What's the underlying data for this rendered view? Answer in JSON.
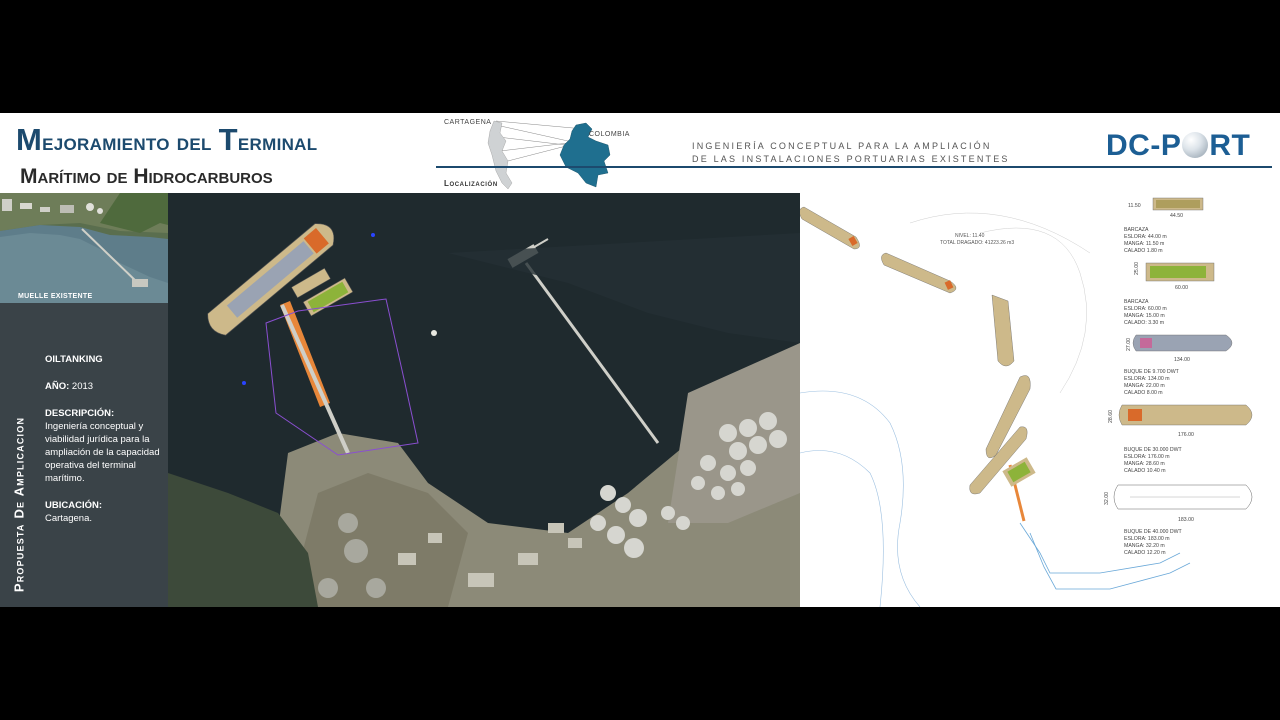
{
  "header": {
    "title_line1_a": "M",
    "title_line1_b": "ejoramiento",
    "title_line1_c": "del",
    "title_line1_d": "T",
    "title_line1_e": "erminal",
    "title_line2": "Marítimo de Hidrocarburos",
    "map_label_city": "CARTAGENA",
    "map_label_country": "COLOMBIA",
    "localizacion_label": "Localización",
    "subtitle_line1": "INGENIERÍA CONCEPTUAL PARA LA AMPLIACIÓN",
    "subtitle_line2": "DE LAS INSTALACIONES PORTUARIAS EXISTENTES",
    "brand_a": "DC-P",
    "brand_b": "RT"
  },
  "left_panel": {
    "photo_caption": "MUELLE EXISTENTE",
    "vertical_title": "Propuesta De Amplicacion",
    "client": "OILTANKING",
    "year_label": "AÑO:",
    "year_value": "2013",
    "description_label": "DESCRIPCIÓN:",
    "description_text": "Ingeniería conceptual y viabilidad jurídica para la ampliación de la capacidad operativa del terminal marítimo.",
    "location_label": "UBICACIÓN:",
    "location_value": "Cartagena."
  },
  "plan": {
    "nivel": "NIVEL: 11.40",
    "dragado": "TOTAL DRAGADO: 41223.26 m3",
    "legend": [
      {
        "dim_top": "11.50",
        "dim_bottom": "44.50",
        "lines": []
      },
      {
        "dim_top": "25.00",
        "dim_bottom": "60.00",
        "lines": [
          "BARCAZA",
          "ESLORA: 44.00 m",
          "MANGA: 11.50 m",
          "CALADO 1.80 m"
        ]
      },
      {
        "dim_top": "27.00",
        "dim_bottom": "134.00",
        "lines": [
          "BARCAZA",
          "ESLORA: 60.00 m",
          "MANGA: 15.00 m",
          "CALADO: 3.30 m"
        ]
      },
      {
        "dim_top": "28.60",
        "dim_bottom": "176.00",
        "lines": [
          "BUQUE DE 9.700 DWT",
          "ESLORA: 134.00 m",
          "MANGA: 22.00 m",
          "CALADO 8.00 m"
        ]
      },
      {
        "dim_top": "32.00",
        "dim_bottom": "183.00",
        "lines": [
          "BUQUE DE 30.000 DWT",
          "ESLORA: 176.00 m",
          "MANGA: 28.60 m",
          "CALADO 10.40 m"
        ]
      },
      {
        "dim_top": "",
        "dim_bottom": "",
        "lines": [
          "BUQUE DE 40.000 DWT",
          "ESLORA: 183.00 m",
          "MANGA: 32.20 m",
          "CALADO 12.20 m"
        ]
      }
    ]
  },
  "colors": {
    "brand_blue": "#1c5e94",
    "title_blue": "#1c4a6e",
    "panel_gray": "#3a4348",
    "ship_tan": "#cdb98a",
    "pier_orange": "#e8873a",
    "barge_green": "#8db33a"
  }
}
